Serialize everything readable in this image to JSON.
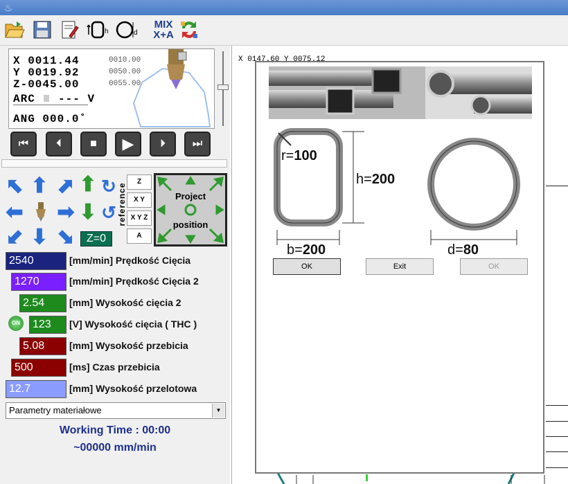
{
  "toolbar": {
    "items": [
      "open-folder-icon",
      "save-icon",
      "edit-document-icon",
      "height-gauge-icon",
      "diameter-icon",
      "mix-icon",
      "refresh-icon"
    ],
    "mix_label_top": "MIX",
    "mix_label_bottom": "X+A"
  },
  "dro": {
    "x_label": "X 0011.44",
    "y_label": "Y 0019.92",
    "z_label": "Z-0045.00",
    "x_small": "0010.00",
    "y_small": "0050.00",
    "z_small": "0055.00",
    "arc_label": "ARC",
    "arc_value": "--- V",
    "ang_label": "ANG 000.0˚"
  },
  "playback": [
    "rewind-start-icon",
    "step-back-icon",
    "stop-icon",
    "play-icon",
    "step-forward-icon",
    "fast-forward-icon"
  ],
  "reference": {
    "vertical_label": "reference",
    "buttons": [
      "Z",
      "X Y",
      "X Y Z",
      "A"
    ],
    "z_zero": "Z=0"
  },
  "project": {
    "line1": "Project",
    "line2": "position"
  },
  "params": [
    {
      "value": "2540",
      "label": "[mm/min] Prędkość Cięcia",
      "color": "#1a237e"
    },
    {
      "value": "1270",
      "label": "[mm/min] Prędkość Cięcia 2",
      "color": "#7a1fff"
    },
    {
      "value": "2.54",
      "label": "[mm] Wysokość cięcia 2",
      "color": "#1e8a1e"
    },
    {
      "value": "123",
      "label": "[V] Wysokość cięcia ( THC )",
      "color": "#1e8a1e"
    },
    {
      "value": "5.08",
      "label": "[mm] Wysokość przebicia",
      "color": "#8b0000"
    },
    {
      "value": "500",
      "label": "[ms] Czas przebicia",
      "color": "#8b0000"
    },
    {
      "value": "12.7",
      "label": "[mm] Wysokość przelotowa",
      "color": "#8b9cff"
    }
  ],
  "thc_toggle": "ON",
  "material_combo": "Parametry materiałowe",
  "working_time": "Working Time : 00:00",
  "speed_readout": "~00000 mm/min",
  "canvas": {
    "coords": "X 0147.60  Y 0075.12"
  },
  "dialog": {
    "r_label": "r=",
    "r_value": "100",
    "h_label": "h=",
    "h_value": "200",
    "b_label": "b=",
    "b_value": "200",
    "d_label": "d=",
    "d_value": "80",
    "ok_left": "OK",
    "exit": "Exit",
    "ok_right": "OK"
  },
  "colors": {
    "title_bar": "#4a7cc6",
    "arc_path": "#1a8080"
  }
}
